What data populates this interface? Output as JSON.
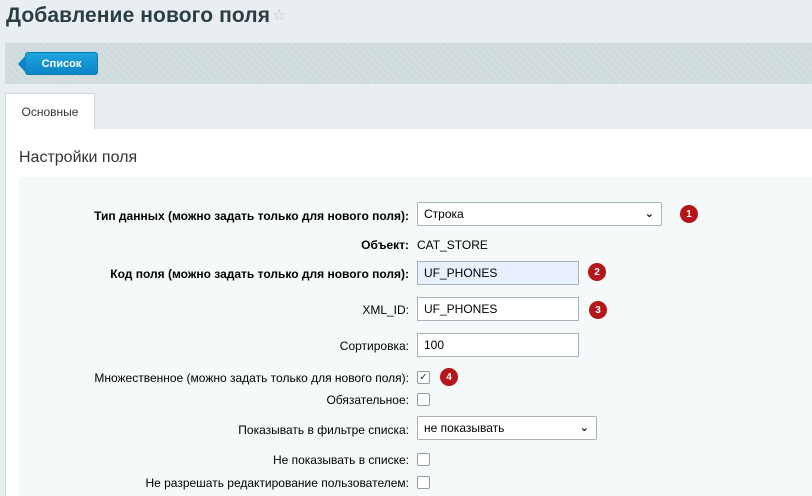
{
  "header": {
    "title": "Добавление нового поля",
    "star_icon": "star-outline-icon"
  },
  "toolbar": {
    "list_button_label": "Список"
  },
  "tabs": [
    {
      "label": "Основные",
      "active": true
    }
  ],
  "section": {
    "title": "Настройки поля"
  },
  "form": {
    "data_type": {
      "label": "Тип данных (можно задать только для нового поля):",
      "value": "Строка"
    },
    "object": {
      "label": "Объект:",
      "value": "CAT_STORE"
    },
    "field_code": {
      "label": "Код поля (можно задать только для нового поля):",
      "value": "UF_PHONES"
    },
    "xml_id": {
      "label": "XML_ID:",
      "value": "UF_PHONES"
    },
    "sort": {
      "label": "Сортировка:",
      "value": "100"
    },
    "multiple": {
      "label": "Множественное (можно задать только для нового поля):",
      "checked": true
    },
    "mandatory": {
      "label": "Обязательное:",
      "checked": false
    },
    "show_filter": {
      "label": "Показывать в фильтре списка:",
      "value": "не показывать"
    },
    "hide_in_list": {
      "label": "Не показывать в списке:",
      "checked": false
    },
    "no_user_edit": {
      "label": "Не разрешать редактирование пользователем:",
      "checked": false
    }
  },
  "markers": [
    "1",
    "2",
    "3",
    "4"
  ],
  "colors": {
    "accent": "#1a9ad6",
    "marker": "#b3171b",
    "toolbar": "#cfdadd"
  }
}
